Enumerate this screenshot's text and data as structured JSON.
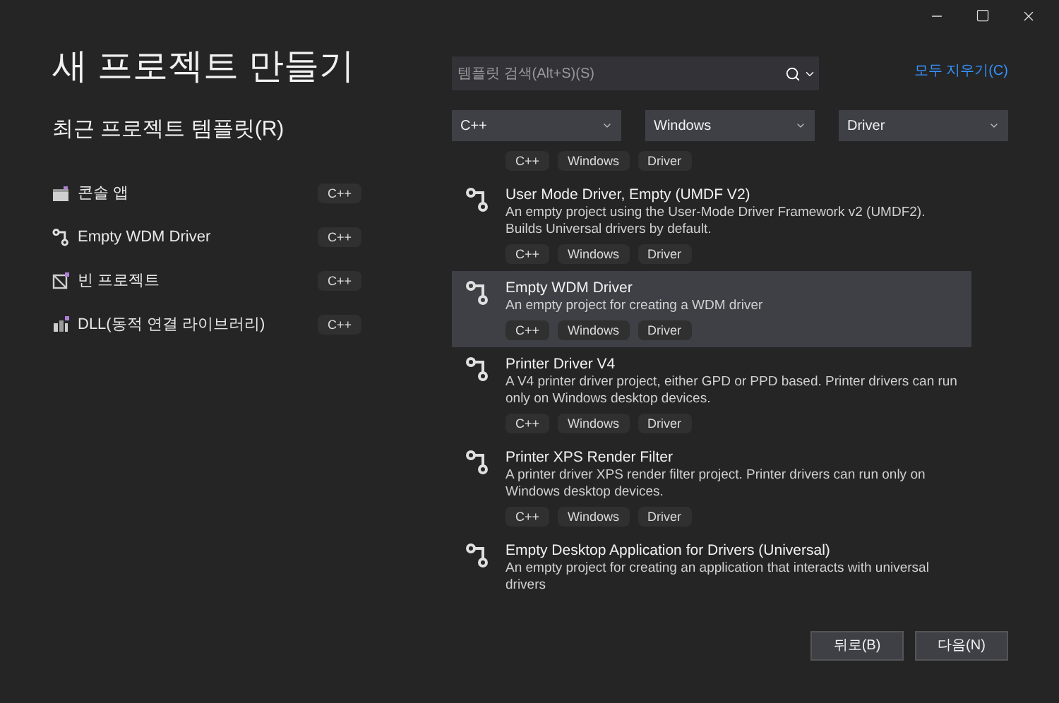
{
  "title": "새 프로젝트 만들기",
  "recent": {
    "heading": "최근 프로젝트 템플릿(R)",
    "items": [
      {
        "kind": "console",
        "name": "콘솔 앱",
        "language": "C++"
      },
      {
        "kind": "driver",
        "name": "Empty WDM Driver",
        "language": "C++"
      },
      {
        "kind": "empty",
        "name": "빈 프로젝트",
        "language": "C++"
      },
      {
        "kind": "dll",
        "name": "DLL(동적 연결 라이브러리)",
        "language": "C++"
      }
    ]
  },
  "search": {
    "placeholder": "템플릿 검색(Alt+S)(S)"
  },
  "clear_all": "모두 지우기(C)",
  "filters": [
    "C++",
    "Windows",
    "Driver"
  ],
  "templates": [
    {
      "tags": [
        "C++",
        "Windows",
        "Driver"
      ],
      "selected": false
    },
    {
      "name": "User Mode Driver, Empty (UMDF V2)",
      "description": "An empty project using the User-Mode Driver Framework v2 (UMDF2). Builds Universal drivers by default.",
      "tags": [
        "C++",
        "Windows",
        "Driver"
      ],
      "selected": false
    },
    {
      "name": "Empty WDM Driver",
      "description": "An empty project for creating a WDM driver",
      "tags": [
        "C++",
        "Windows",
        "Driver"
      ],
      "selected": true
    },
    {
      "name": "Printer Driver V4",
      "description": "A V4 printer driver project, either GPD or PPD based. Printer drivers can run only on Windows desktop devices.",
      "tags": [
        "C++",
        "Windows",
        "Driver"
      ],
      "selected": false
    },
    {
      "name": "Printer XPS Render Filter",
      "description": "A printer driver XPS render filter project. Printer drivers can run only on Windows desktop devices.",
      "tags": [
        "C++",
        "Windows",
        "Driver"
      ],
      "selected": false
    },
    {
      "name": "Empty Desktop Application for Drivers (Universal)",
      "description": "An empty project for creating an application that interacts with universal drivers",
      "selected": false
    }
  ],
  "buttons": [
    "뒤로(B)",
    "다음(N)"
  ]
}
